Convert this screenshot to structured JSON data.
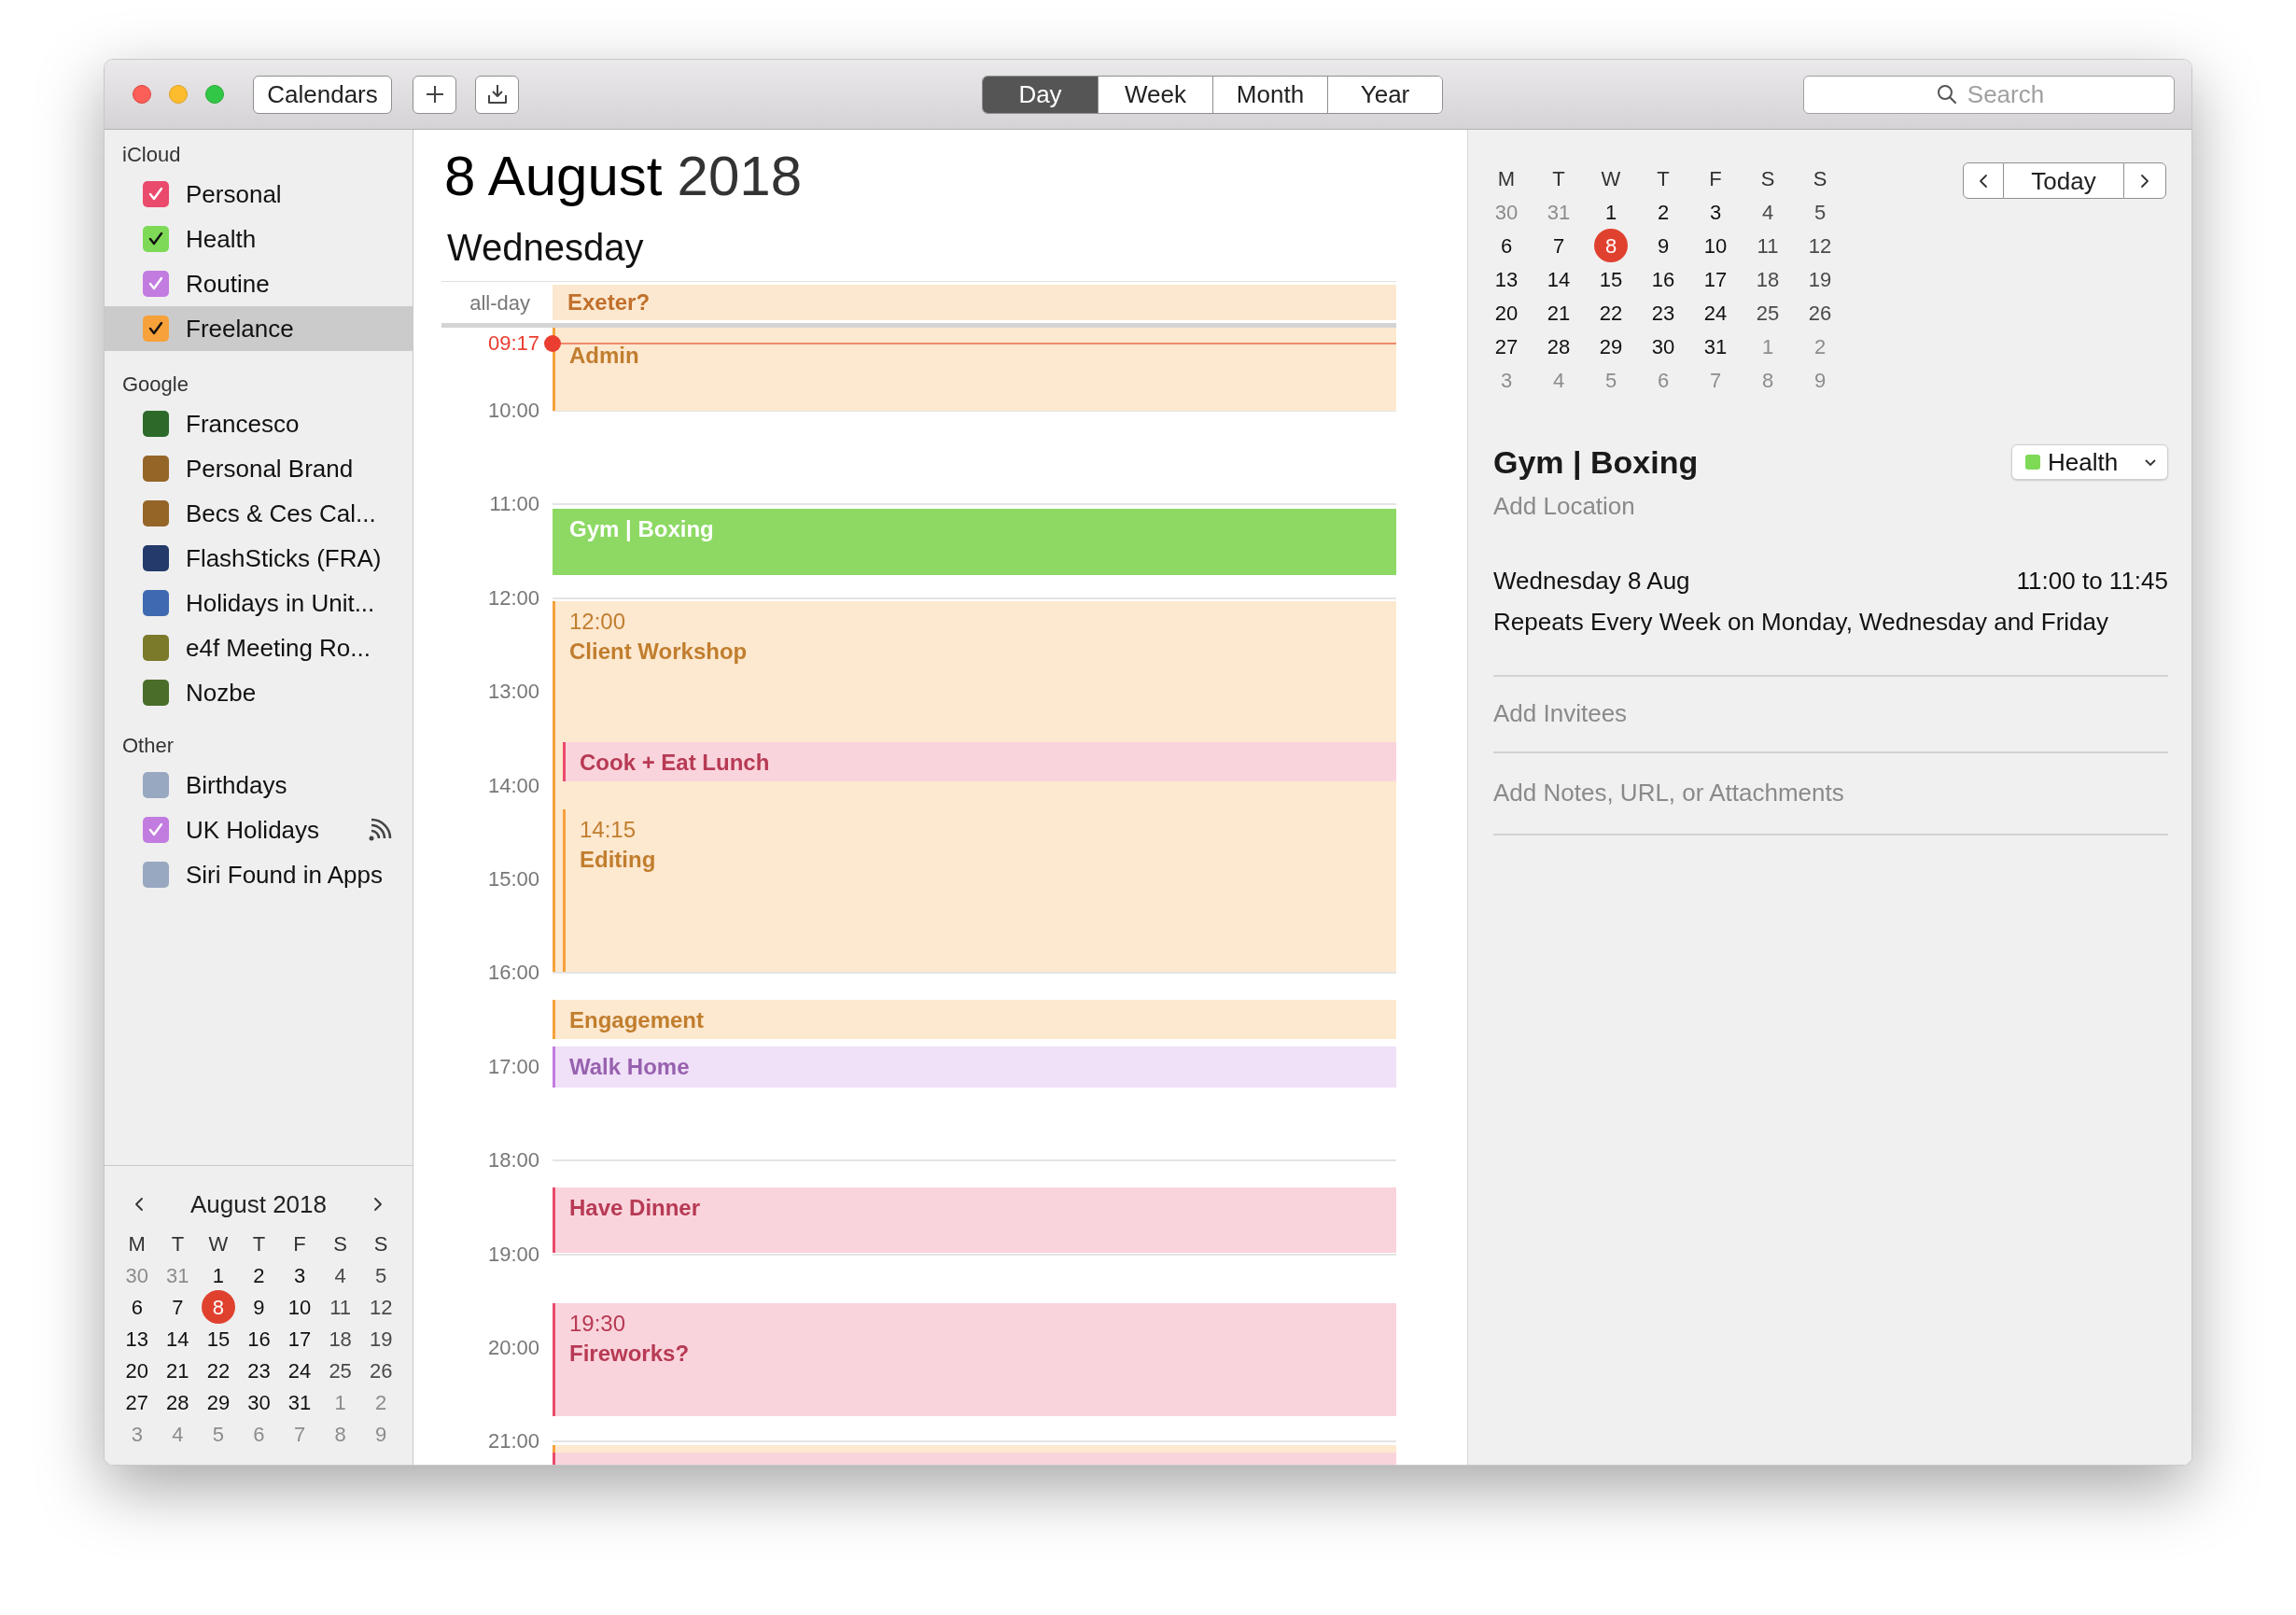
{
  "toolbar": {
    "calendars_button": "Calendars",
    "views": [
      {
        "label": "Day",
        "selected": true
      },
      {
        "label": "Week",
        "selected": false
      },
      {
        "label": "Month",
        "selected": false
      },
      {
        "label": "Year",
        "selected": false
      }
    ],
    "search": {
      "placeholder": "Search"
    }
  },
  "sidebar": {
    "groups": [
      {
        "title": "iCloud",
        "items": [
          {
            "label": "Personal",
            "color": "#ea4a6c",
            "checked": true,
            "selected": false,
            "subscribed": false
          },
          {
            "label": "Health",
            "color": "#7ed957",
            "checked": true,
            "selected": false,
            "subscribed": false
          },
          {
            "label": "Routine",
            "color": "#c27ce0",
            "checked": true,
            "selected": false,
            "subscribed": false
          },
          {
            "label": "Freelance",
            "color": "#f7a13b",
            "checked": true,
            "selected": true,
            "subscribed": false
          }
        ]
      },
      {
        "title": "Google",
        "items": [
          {
            "label": "Francesco",
            "color": "#2d6a2a",
            "checked": false,
            "selected": false,
            "subscribed": false
          },
          {
            "label": "Personal Brand",
            "color": "#956528",
            "checked": false,
            "selected": false,
            "subscribed": false
          },
          {
            "label": "Becs & Ces Cal...",
            "color": "#956528",
            "checked": false,
            "selected": false,
            "subscribed": false
          },
          {
            "label": "FlashSticks (FRA)",
            "color": "#233a6a",
            "checked": false,
            "selected": false,
            "subscribed": false
          },
          {
            "label": "Holidays in Unit...",
            "color": "#3f6ab2",
            "checked": false,
            "selected": false,
            "subscribed": false
          },
          {
            "label": "e4f Meeting Ro...",
            "color": "#7a7a2a",
            "checked": false,
            "selected": false,
            "subscribed": false
          },
          {
            "label": "Nozbe",
            "color": "#4a6e2a",
            "checked": false,
            "selected": false,
            "subscribed": false
          }
        ]
      },
      {
        "title": "Other",
        "items": [
          {
            "label": "Birthdays",
            "color": "#98a8c0",
            "checked": false,
            "selected": false,
            "subscribed": false
          },
          {
            "label": "UK Holidays",
            "color": "#c27ce0",
            "checked": true,
            "selected": false,
            "subscribed": true
          },
          {
            "label": "Siri Found in Apps",
            "color": "#98a8c0",
            "checked": false,
            "selected": false,
            "subscribed": false
          }
        ]
      }
    ],
    "mini_calendar": {
      "title": "August 2018",
      "weekdays": [
        "M",
        "T",
        "W",
        "T",
        "F",
        "S",
        "S"
      ],
      "weeks": [
        [
          {
            "d": "30",
            "muted": true,
            "selected": false
          },
          {
            "d": "31",
            "muted": true,
            "selected": false
          },
          {
            "d": "1",
            "muted": false,
            "selected": false
          },
          {
            "d": "2",
            "muted": false,
            "selected": false
          },
          {
            "d": "3",
            "muted": false,
            "selected": false
          },
          {
            "d": "4",
            "muted": false,
            "selected": false
          },
          {
            "d": "5",
            "muted": false,
            "selected": false
          }
        ],
        [
          {
            "d": "6",
            "muted": false,
            "selected": false
          },
          {
            "d": "7",
            "muted": false,
            "selected": false
          },
          {
            "d": "8",
            "muted": false,
            "selected": true
          },
          {
            "d": "9",
            "muted": false,
            "selected": false
          },
          {
            "d": "10",
            "muted": false,
            "selected": false
          },
          {
            "d": "11",
            "muted": false,
            "selected": false
          },
          {
            "d": "12",
            "muted": false,
            "selected": false
          }
        ],
        [
          {
            "d": "13",
            "muted": false,
            "selected": false
          },
          {
            "d": "14",
            "muted": false,
            "selected": false
          },
          {
            "d": "15",
            "muted": false,
            "selected": false
          },
          {
            "d": "16",
            "muted": false,
            "selected": false
          },
          {
            "d": "17",
            "muted": false,
            "selected": false
          },
          {
            "d": "18",
            "muted": false,
            "selected": false
          },
          {
            "d": "19",
            "muted": false,
            "selected": false
          }
        ],
        [
          {
            "d": "20",
            "muted": false,
            "selected": false
          },
          {
            "d": "21",
            "muted": false,
            "selected": false
          },
          {
            "d": "22",
            "muted": false,
            "selected": false
          },
          {
            "d": "23",
            "muted": false,
            "selected": false
          },
          {
            "d": "24",
            "muted": false,
            "selected": false
          },
          {
            "d": "25",
            "muted": false,
            "selected": false
          },
          {
            "d": "26",
            "muted": false,
            "selected": false
          }
        ],
        [
          {
            "d": "27",
            "muted": false,
            "selected": false
          },
          {
            "d": "28",
            "muted": false,
            "selected": false
          },
          {
            "d": "29",
            "muted": false,
            "selected": false
          },
          {
            "d": "30",
            "muted": false,
            "selected": false
          },
          {
            "d": "31",
            "muted": false,
            "selected": false
          },
          {
            "d": "1",
            "muted": true,
            "selected": false
          },
          {
            "d": "2",
            "muted": true,
            "selected": false
          }
        ],
        [
          {
            "d": "3",
            "muted": true,
            "selected": false
          },
          {
            "d": "4",
            "muted": true,
            "selected": false
          },
          {
            "d": "5",
            "muted": true,
            "selected": false
          },
          {
            "d": "6",
            "muted": true,
            "selected": false
          },
          {
            "d": "7",
            "muted": true,
            "selected": false
          },
          {
            "d": "8",
            "muted": true,
            "selected": false
          },
          {
            "d": "9",
            "muted": true,
            "selected": false
          }
        ]
      ]
    }
  },
  "day_view": {
    "date": "8 August",
    "year": "2018",
    "weekday": "Wednesday",
    "all_day_label": "all-day",
    "all_day_events": [
      {
        "title": "Exeter?"
      }
    ],
    "now": "09:17",
    "hours": [
      "10:00",
      "11:00",
      "12:00",
      "13:00",
      "14:00",
      "15:00",
      "16:00",
      "17:00",
      "18:00",
      "19:00",
      "20:00",
      "21:00"
    ],
    "events": [
      {
        "title": "Admin",
        "color": "#f7a13b",
        "selected": false
      },
      {
        "title": "Gym | Boxing",
        "color": "#8dd964",
        "selected": true
      },
      {
        "time": "12:00",
        "title": "Client Workshop",
        "color": "#f7a13b",
        "selected": false
      },
      {
        "title": "Cook + Eat Lunch",
        "color": "#ea4a6c",
        "selected": false
      },
      {
        "time": "14:15",
        "title": "Editing",
        "color": "#f7a13b",
        "selected": false
      },
      {
        "title": "Engagement",
        "color": "#f7a13b",
        "selected": false
      },
      {
        "title": "Walk Home",
        "color": "#c27ce0",
        "selected": false
      },
      {
        "title": "Have Dinner",
        "color": "#ea4a6c",
        "selected": false
      },
      {
        "time": "19:30",
        "title": "Fireworks?",
        "color": "#ea4a6c",
        "selected": false
      },
      {
        "color": "#f7a13b",
        "selected": false
      },
      {
        "color": "#ea4a6c",
        "selected": false
      }
    ]
  },
  "inspector": {
    "nav": {
      "today": "Today"
    },
    "mini_calendar": {
      "weekdays": [
        "M",
        "T",
        "W",
        "T",
        "F",
        "S",
        "S"
      ],
      "weeks": [
        [
          {
            "d": "30",
            "muted": true,
            "selected": false
          },
          {
            "d": "31",
            "muted": true,
            "selected": false
          },
          {
            "d": "1",
            "muted": false,
            "selected": false
          },
          {
            "d": "2",
            "muted": false,
            "selected": false
          },
          {
            "d": "3",
            "muted": false,
            "selected": false
          },
          {
            "d": "4",
            "muted": false,
            "selected": false
          },
          {
            "d": "5",
            "muted": false,
            "selected": false
          }
        ],
        [
          {
            "d": "6",
            "muted": false,
            "selected": false
          },
          {
            "d": "7",
            "muted": false,
            "selected": false
          },
          {
            "d": "8",
            "muted": false,
            "selected": true
          },
          {
            "d": "9",
            "muted": false,
            "selected": false
          },
          {
            "d": "10",
            "muted": false,
            "selected": false
          },
          {
            "d": "11",
            "muted": false,
            "selected": false
          },
          {
            "d": "12",
            "muted": false,
            "selected": false
          }
        ],
        [
          {
            "d": "13",
            "muted": false,
            "selected": false
          },
          {
            "d": "14",
            "muted": false,
            "selected": false
          },
          {
            "d": "15",
            "muted": false,
            "selected": false
          },
          {
            "d": "16",
            "muted": false,
            "selected": false
          },
          {
            "d": "17",
            "muted": false,
            "selected": false
          },
          {
            "d": "18",
            "muted": false,
            "selected": false
          },
          {
            "d": "19",
            "muted": false,
            "selected": false
          }
        ],
        [
          {
            "d": "20",
            "muted": false,
            "selected": false
          },
          {
            "d": "21",
            "muted": false,
            "selected": false
          },
          {
            "d": "22",
            "muted": false,
            "selected": false
          },
          {
            "d": "23",
            "muted": false,
            "selected": false
          },
          {
            "d": "24",
            "muted": false,
            "selected": false
          },
          {
            "d": "25",
            "muted": false,
            "selected": false
          },
          {
            "d": "26",
            "muted": false,
            "selected": false
          }
        ],
        [
          {
            "d": "27",
            "muted": false,
            "selected": false
          },
          {
            "d": "28",
            "muted": false,
            "selected": false
          },
          {
            "d": "29",
            "muted": false,
            "selected": false
          },
          {
            "d": "30",
            "muted": false,
            "selected": false
          },
          {
            "d": "31",
            "muted": false,
            "selected": false
          },
          {
            "d": "1",
            "muted": true,
            "selected": false
          },
          {
            "d": "2",
            "muted": true,
            "selected": false
          }
        ],
        [
          {
            "d": "3",
            "muted": true,
            "selected": false
          },
          {
            "d": "4",
            "muted": true,
            "selected": false
          },
          {
            "d": "5",
            "muted": true,
            "selected": false
          },
          {
            "d": "6",
            "muted": true,
            "selected": false
          },
          {
            "d": "7",
            "muted": true,
            "selected": false
          },
          {
            "d": "8",
            "muted": true,
            "selected": false
          },
          {
            "d": "9",
            "muted": true,
            "selected": false
          }
        ]
      ]
    },
    "event": {
      "title": "Gym | Boxing",
      "calendar": {
        "label": "Health",
        "color": "#7ed957"
      },
      "location_placeholder": "Add Location",
      "date": "Wednesday 8 Aug",
      "time": "11:00 to 11:45",
      "repeat": "Repeats Every Week on Monday, Wednesday and Friday",
      "invitees_placeholder": "Add Invitees",
      "notes_placeholder": "Add Notes, URL, or Attachments"
    }
  }
}
